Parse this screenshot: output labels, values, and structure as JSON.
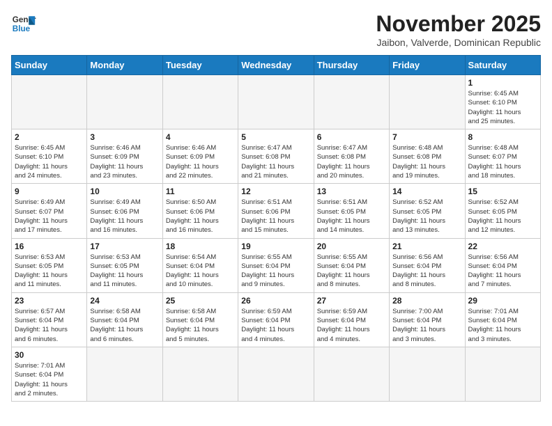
{
  "header": {
    "logo_line1": "General",
    "logo_line2": "Blue",
    "month": "November 2025",
    "location": "Jaibon, Valverde, Dominican Republic"
  },
  "days_of_week": [
    "Sunday",
    "Monday",
    "Tuesday",
    "Wednesday",
    "Thursday",
    "Friday",
    "Saturday"
  ],
  "weeks": [
    [
      {
        "day": "",
        "info": ""
      },
      {
        "day": "",
        "info": ""
      },
      {
        "day": "",
        "info": ""
      },
      {
        "day": "",
        "info": ""
      },
      {
        "day": "",
        "info": ""
      },
      {
        "day": "",
        "info": ""
      },
      {
        "day": "1",
        "info": "Sunrise: 6:45 AM\nSunset: 6:10 PM\nDaylight: 11 hours\nand 25 minutes."
      }
    ],
    [
      {
        "day": "2",
        "info": "Sunrise: 6:45 AM\nSunset: 6:10 PM\nDaylight: 11 hours\nand 24 minutes."
      },
      {
        "day": "3",
        "info": "Sunrise: 6:46 AM\nSunset: 6:09 PM\nDaylight: 11 hours\nand 23 minutes."
      },
      {
        "day": "4",
        "info": "Sunrise: 6:46 AM\nSunset: 6:09 PM\nDaylight: 11 hours\nand 22 minutes."
      },
      {
        "day": "5",
        "info": "Sunrise: 6:47 AM\nSunset: 6:08 PM\nDaylight: 11 hours\nand 21 minutes."
      },
      {
        "day": "6",
        "info": "Sunrise: 6:47 AM\nSunset: 6:08 PM\nDaylight: 11 hours\nand 20 minutes."
      },
      {
        "day": "7",
        "info": "Sunrise: 6:48 AM\nSunset: 6:08 PM\nDaylight: 11 hours\nand 19 minutes."
      },
      {
        "day": "8",
        "info": "Sunrise: 6:48 AM\nSunset: 6:07 PM\nDaylight: 11 hours\nand 18 minutes."
      }
    ],
    [
      {
        "day": "9",
        "info": "Sunrise: 6:49 AM\nSunset: 6:07 PM\nDaylight: 11 hours\nand 17 minutes."
      },
      {
        "day": "10",
        "info": "Sunrise: 6:49 AM\nSunset: 6:06 PM\nDaylight: 11 hours\nand 16 minutes."
      },
      {
        "day": "11",
        "info": "Sunrise: 6:50 AM\nSunset: 6:06 PM\nDaylight: 11 hours\nand 16 minutes."
      },
      {
        "day": "12",
        "info": "Sunrise: 6:51 AM\nSunset: 6:06 PM\nDaylight: 11 hours\nand 15 minutes."
      },
      {
        "day": "13",
        "info": "Sunrise: 6:51 AM\nSunset: 6:05 PM\nDaylight: 11 hours\nand 14 minutes."
      },
      {
        "day": "14",
        "info": "Sunrise: 6:52 AM\nSunset: 6:05 PM\nDaylight: 11 hours\nand 13 minutes."
      },
      {
        "day": "15",
        "info": "Sunrise: 6:52 AM\nSunset: 6:05 PM\nDaylight: 11 hours\nand 12 minutes."
      }
    ],
    [
      {
        "day": "16",
        "info": "Sunrise: 6:53 AM\nSunset: 6:05 PM\nDaylight: 11 hours\nand 11 minutes."
      },
      {
        "day": "17",
        "info": "Sunrise: 6:53 AM\nSunset: 6:05 PM\nDaylight: 11 hours\nand 11 minutes."
      },
      {
        "day": "18",
        "info": "Sunrise: 6:54 AM\nSunset: 6:04 PM\nDaylight: 11 hours\nand 10 minutes."
      },
      {
        "day": "19",
        "info": "Sunrise: 6:55 AM\nSunset: 6:04 PM\nDaylight: 11 hours\nand 9 minutes."
      },
      {
        "day": "20",
        "info": "Sunrise: 6:55 AM\nSunset: 6:04 PM\nDaylight: 11 hours\nand 8 minutes."
      },
      {
        "day": "21",
        "info": "Sunrise: 6:56 AM\nSunset: 6:04 PM\nDaylight: 11 hours\nand 8 minutes."
      },
      {
        "day": "22",
        "info": "Sunrise: 6:56 AM\nSunset: 6:04 PM\nDaylight: 11 hours\nand 7 minutes."
      }
    ],
    [
      {
        "day": "23",
        "info": "Sunrise: 6:57 AM\nSunset: 6:04 PM\nDaylight: 11 hours\nand 6 minutes."
      },
      {
        "day": "24",
        "info": "Sunrise: 6:58 AM\nSunset: 6:04 PM\nDaylight: 11 hours\nand 6 minutes."
      },
      {
        "day": "25",
        "info": "Sunrise: 6:58 AM\nSunset: 6:04 PM\nDaylight: 11 hours\nand 5 minutes."
      },
      {
        "day": "26",
        "info": "Sunrise: 6:59 AM\nSunset: 6:04 PM\nDaylight: 11 hours\nand 4 minutes."
      },
      {
        "day": "27",
        "info": "Sunrise: 6:59 AM\nSunset: 6:04 PM\nDaylight: 11 hours\nand 4 minutes."
      },
      {
        "day": "28",
        "info": "Sunrise: 7:00 AM\nSunset: 6:04 PM\nDaylight: 11 hours\nand 3 minutes."
      },
      {
        "day": "29",
        "info": "Sunrise: 7:01 AM\nSunset: 6:04 PM\nDaylight: 11 hours\nand 3 minutes."
      }
    ],
    [
      {
        "day": "30",
        "info": "Sunrise: 7:01 AM\nSunset: 6:04 PM\nDaylight: 11 hours\nand 2 minutes."
      },
      {
        "day": "",
        "info": ""
      },
      {
        "day": "",
        "info": ""
      },
      {
        "day": "",
        "info": ""
      },
      {
        "day": "",
        "info": ""
      },
      {
        "day": "",
        "info": ""
      },
      {
        "day": "",
        "info": ""
      }
    ]
  ]
}
